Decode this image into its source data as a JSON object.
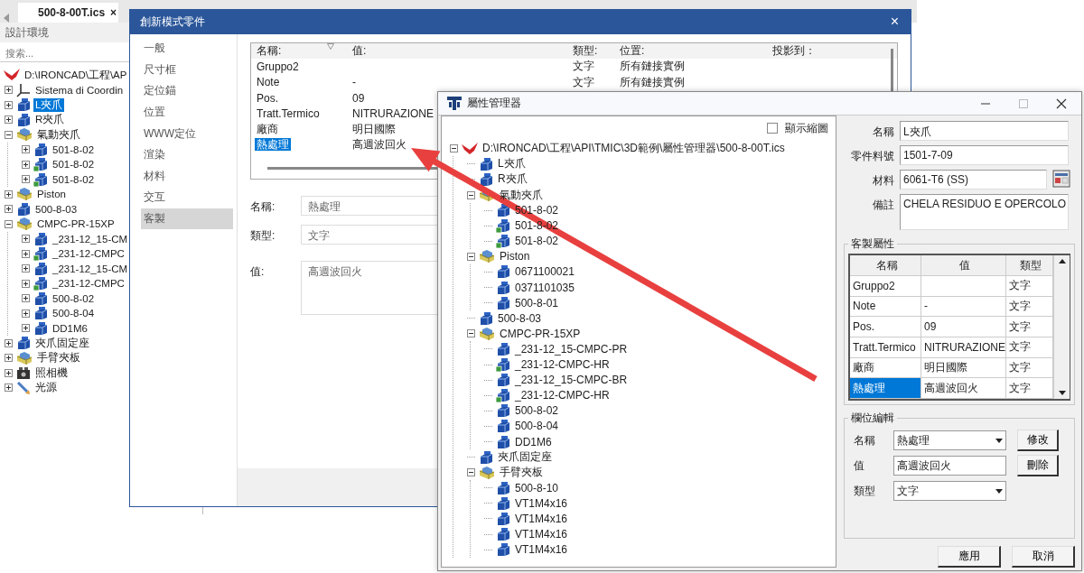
{
  "background_app": {
    "tab": {
      "label": "500-8-00T.ics",
      "close": "×"
    },
    "panel_title": "設計環境",
    "search": {
      "placeholder": "搜索..."
    },
    "tree": {
      "root": {
        "label": "D:\\IRONCAD\\工程\\AP",
        "kind": "root"
      },
      "items": [
        {
          "label": "Sistema di Coordin",
          "kind": "coordinate",
          "expanded": false,
          "selected": false
        },
        {
          "label": "L夾爪",
          "kind": "part",
          "expanded": false,
          "selected": true
        },
        {
          "label": "R夾爪",
          "kind": "part",
          "expanded": false,
          "selected": false
        },
        {
          "label": "氣動夾爪",
          "kind": "assembly",
          "expanded": true,
          "selected": false,
          "children": [
            {
              "label": "501-8-02",
              "kind": "part",
              "expanded": false,
              "selected": false
            },
            {
              "label": "501-8-02",
              "kind": "linked-part",
              "expanded": false,
              "selected": false
            },
            {
              "label": "501-8-02",
              "kind": "linked-part",
              "expanded": false,
              "selected": false
            }
          ]
        },
        {
          "label": "Piston",
          "kind": "assembly",
          "expanded": false,
          "selected": false
        },
        {
          "label": "500-8-03",
          "kind": "part",
          "expanded": false,
          "selected": false
        },
        {
          "label": "CMPC-PR-15XP",
          "kind": "assembly",
          "expanded": true,
          "selected": false,
          "children": [
            {
              "label": "_231-12_15-CM",
              "kind": "part",
              "expanded": false,
              "selected": false
            },
            {
              "label": "_231-12-CMPC",
              "kind": "linked-part",
              "expanded": false,
              "selected": false
            },
            {
              "label": "_231-12_15-CM",
              "kind": "part",
              "expanded": false,
              "selected": false
            },
            {
              "label": "_231-12-CMPC",
              "kind": "linked-part",
              "expanded": false,
              "selected": false
            },
            {
              "label": "500-8-02",
              "kind": "part",
              "expanded": false,
              "selected": false
            },
            {
              "label": "500-8-04",
              "kind": "part",
              "expanded": false,
              "selected": false
            },
            {
              "label": "DD1M6",
              "kind": "part",
              "expanded": false,
              "selected": false
            }
          ]
        },
        {
          "label": "夾爪固定座",
          "kind": "part",
          "expanded": false,
          "selected": false
        },
        {
          "label": "手臂夾板",
          "kind": "assembly",
          "expanded": false,
          "selected": false
        },
        {
          "label": "照相機",
          "kind": "camera",
          "expanded": false,
          "selected": false
        },
        {
          "label": "光源",
          "kind": "light",
          "expanded": false,
          "selected": false
        }
      ]
    }
  },
  "dialog": {
    "title": "創新模式零件",
    "close": "×",
    "nav": [
      {
        "label": "一般",
        "selected": false
      },
      {
        "label": "尺寸框",
        "selected": false
      },
      {
        "label": "定位錨",
        "selected": false
      },
      {
        "label": "位置",
        "selected": false
      },
      {
        "label": "WWW定位",
        "selected": false
      },
      {
        "label": "渲染",
        "selected": false
      },
      {
        "label": "材料",
        "selected": false
      },
      {
        "label": "交互",
        "selected": false
      },
      {
        "label": "客製",
        "selected": true
      }
    ],
    "table": {
      "columns": [
        "名稱:",
        "值:",
        "類型:",
        "位置:",
        "投影到："
      ],
      "rows": [
        {
          "name": "Gruppo2",
          "type": "文字",
          "location": "所有鏈接實例",
          "selected": false
        },
        {
          "name": "Note",
          "value": "-",
          "type": "文字",
          "location": "所有鏈接實例",
          "selected": false
        },
        {
          "name": "Pos.",
          "value": "09",
          "selected": false
        },
        {
          "name": "Tratt.Termico",
          "value": "NITRURAZIONE",
          "selected": false
        },
        {
          "name": "廠商",
          "value": "明日國際",
          "selected": false
        },
        {
          "name": "熱處理",
          "value": "高週波回火",
          "selected": true
        }
      ]
    },
    "fields": [
      {
        "label": "名稱:",
        "value": "熱處理",
        "kind": "text"
      },
      {
        "label": "類型:",
        "value": "文字",
        "kind": "text"
      },
      {
        "label": "值:",
        "value": "高週波回火",
        "kind": "memo"
      }
    ]
  },
  "property_manager": {
    "title": "屬性管理器",
    "show_thumbnails": {
      "label": "顯示縮圖",
      "checked": false
    },
    "tree": {
      "label": "D:\\IRONCAD\\工程\\API\\TMIC\\3D範例\\屬性管理器\\500-8-00T.ics",
      "kind": "root",
      "expanded": true,
      "children": [
        {
          "label": "L夾爪",
          "kind": "part"
        },
        {
          "label": "R夾爪",
          "kind": "part"
        },
        {
          "label": "氣動夾爪",
          "kind": "assembly",
          "expanded": true,
          "children": [
            {
              "label": "501-8-02",
              "kind": "part"
            },
            {
              "label": "501-8-02",
              "kind": "linked-part"
            },
            {
              "label": "501-8-02",
              "kind": "linked-part"
            }
          ]
        },
        {
          "label": "Piston",
          "kind": "assembly",
          "expanded": true,
          "children": [
            {
              "label": "0671100021",
              "kind": "part"
            },
            {
              "label": "0371101035",
              "kind": "part"
            },
            {
              "label": "500-8-01",
              "kind": "part"
            }
          ]
        },
        {
          "label": "500-8-03",
          "kind": "part"
        },
        {
          "label": "CMPC-PR-15XP",
          "kind": "assembly",
          "expanded": true,
          "children": [
            {
              "label": "_231-12_15-CMPC-PR",
              "kind": "part"
            },
            {
              "label": "_231-12-CMPC-HR",
              "kind": "linked-part"
            },
            {
              "label": "_231-12_15-CMPC-BR",
              "kind": "part"
            },
            {
              "label": "_231-12-CMPC-HR",
              "kind": "linked-part"
            },
            {
              "label": "500-8-02",
              "kind": "part"
            },
            {
              "label": "500-8-04",
              "kind": "part"
            },
            {
              "label": "DD1M6",
              "kind": "part"
            }
          ]
        },
        {
          "label": "夾爪固定座",
          "kind": "part"
        },
        {
          "label": "手臂夾板",
          "kind": "assembly",
          "expanded": true,
          "children": [
            {
              "label": "500-8-10",
              "kind": "part"
            },
            {
              "label": "VT1M4x16",
              "kind": "part"
            },
            {
              "label": "VT1M4x16",
              "kind": "part"
            },
            {
              "label": "VT1M4x16",
              "kind": "part"
            },
            {
              "label": "VT1M4x16",
              "kind": "part"
            }
          ]
        }
      ]
    },
    "fields": [
      {
        "label": "名稱",
        "value": "L夾爪",
        "kind": "text"
      },
      {
        "label": "零件料號",
        "value": "1501-7-09",
        "kind": "text"
      },
      {
        "label": "材料",
        "value": "6061-T6 (SS)",
        "kind": "picker"
      },
      {
        "label": "備註",
        "value": "CHELA RESIDUO E OPERCOLO",
        "kind": "memo"
      }
    ],
    "custom_properties": {
      "title": "客製屬性",
      "columns": [
        "名稱",
        "值",
        "類型"
      ],
      "rows": [
        {
          "name": "Gruppo2",
          "type": "文字",
          "selected": false
        },
        {
          "name": "Note",
          "value": "-",
          "type": "文字",
          "selected": false
        },
        {
          "name": "Pos.",
          "value": "09",
          "type": "文字",
          "selected": false
        },
        {
          "name": "Tratt.Termico",
          "value": "NITRURAZIONE",
          "type": "文字",
          "selected": false
        },
        {
          "name": "廠商",
          "value": "明日國際",
          "type": "文字",
          "selected": false
        },
        {
          "name": "熱處理",
          "value": "高週波回火",
          "type": "文字",
          "selected": true
        }
      ]
    },
    "field_editor": {
      "title": "欄位編輯",
      "fields": [
        {
          "label": "名稱",
          "value": "熱處理",
          "kind": "combo",
          "button": "修改"
        },
        {
          "label": "值",
          "value": "高週波回火",
          "kind": "text",
          "button": "刪除"
        },
        {
          "label": "類型",
          "value": "文字",
          "kind": "combo"
        }
      ]
    },
    "buttons": [
      "應用",
      "取消"
    ]
  }
}
